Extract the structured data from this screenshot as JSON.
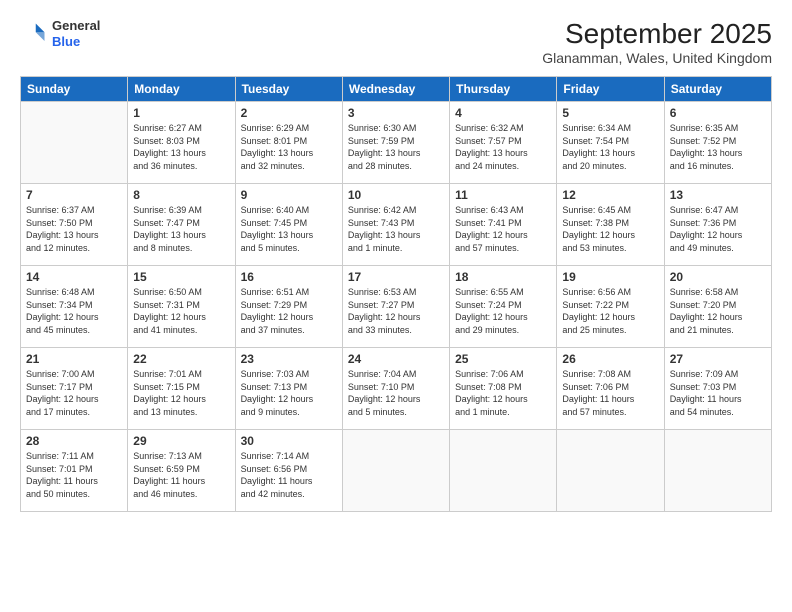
{
  "header": {
    "logo_general": "General",
    "logo_blue": "Blue",
    "month_title": "September 2025",
    "location": "Glanamman, Wales, United Kingdom"
  },
  "weekdays": [
    "Sunday",
    "Monday",
    "Tuesday",
    "Wednesday",
    "Thursday",
    "Friday",
    "Saturday"
  ],
  "weeks": [
    [
      {
        "day": "",
        "info": ""
      },
      {
        "day": "1",
        "info": "Sunrise: 6:27 AM\nSunset: 8:03 PM\nDaylight: 13 hours\nand 36 minutes."
      },
      {
        "day": "2",
        "info": "Sunrise: 6:29 AM\nSunset: 8:01 PM\nDaylight: 13 hours\nand 32 minutes."
      },
      {
        "day": "3",
        "info": "Sunrise: 6:30 AM\nSunset: 7:59 PM\nDaylight: 13 hours\nand 28 minutes."
      },
      {
        "day": "4",
        "info": "Sunrise: 6:32 AM\nSunset: 7:57 PM\nDaylight: 13 hours\nand 24 minutes."
      },
      {
        "day": "5",
        "info": "Sunrise: 6:34 AM\nSunset: 7:54 PM\nDaylight: 13 hours\nand 20 minutes."
      },
      {
        "day": "6",
        "info": "Sunrise: 6:35 AM\nSunset: 7:52 PM\nDaylight: 13 hours\nand 16 minutes."
      }
    ],
    [
      {
        "day": "7",
        "info": "Sunrise: 6:37 AM\nSunset: 7:50 PM\nDaylight: 13 hours\nand 12 minutes."
      },
      {
        "day": "8",
        "info": "Sunrise: 6:39 AM\nSunset: 7:47 PM\nDaylight: 13 hours\nand 8 minutes."
      },
      {
        "day": "9",
        "info": "Sunrise: 6:40 AM\nSunset: 7:45 PM\nDaylight: 13 hours\nand 5 minutes."
      },
      {
        "day": "10",
        "info": "Sunrise: 6:42 AM\nSunset: 7:43 PM\nDaylight: 13 hours\nand 1 minute."
      },
      {
        "day": "11",
        "info": "Sunrise: 6:43 AM\nSunset: 7:41 PM\nDaylight: 12 hours\nand 57 minutes."
      },
      {
        "day": "12",
        "info": "Sunrise: 6:45 AM\nSunset: 7:38 PM\nDaylight: 12 hours\nand 53 minutes."
      },
      {
        "day": "13",
        "info": "Sunrise: 6:47 AM\nSunset: 7:36 PM\nDaylight: 12 hours\nand 49 minutes."
      }
    ],
    [
      {
        "day": "14",
        "info": "Sunrise: 6:48 AM\nSunset: 7:34 PM\nDaylight: 12 hours\nand 45 minutes."
      },
      {
        "day": "15",
        "info": "Sunrise: 6:50 AM\nSunset: 7:31 PM\nDaylight: 12 hours\nand 41 minutes."
      },
      {
        "day": "16",
        "info": "Sunrise: 6:51 AM\nSunset: 7:29 PM\nDaylight: 12 hours\nand 37 minutes."
      },
      {
        "day": "17",
        "info": "Sunrise: 6:53 AM\nSunset: 7:27 PM\nDaylight: 12 hours\nand 33 minutes."
      },
      {
        "day": "18",
        "info": "Sunrise: 6:55 AM\nSunset: 7:24 PM\nDaylight: 12 hours\nand 29 minutes."
      },
      {
        "day": "19",
        "info": "Sunrise: 6:56 AM\nSunset: 7:22 PM\nDaylight: 12 hours\nand 25 minutes."
      },
      {
        "day": "20",
        "info": "Sunrise: 6:58 AM\nSunset: 7:20 PM\nDaylight: 12 hours\nand 21 minutes."
      }
    ],
    [
      {
        "day": "21",
        "info": "Sunrise: 7:00 AM\nSunset: 7:17 PM\nDaylight: 12 hours\nand 17 minutes."
      },
      {
        "day": "22",
        "info": "Sunrise: 7:01 AM\nSunset: 7:15 PM\nDaylight: 12 hours\nand 13 minutes."
      },
      {
        "day": "23",
        "info": "Sunrise: 7:03 AM\nSunset: 7:13 PM\nDaylight: 12 hours\nand 9 minutes."
      },
      {
        "day": "24",
        "info": "Sunrise: 7:04 AM\nSunset: 7:10 PM\nDaylight: 12 hours\nand 5 minutes."
      },
      {
        "day": "25",
        "info": "Sunrise: 7:06 AM\nSunset: 7:08 PM\nDaylight: 12 hours\nand 1 minute."
      },
      {
        "day": "26",
        "info": "Sunrise: 7:08 AM\nSunset: 7:06 PM\nDaylight: 11 hours\nand 57 minutes."
      },
      {
        "day": "27",
        "info": "Sunrise: 7:09 AM\nSunset: 7:03 PM\nDaylight: 11 hours\nand 54 minutes."
      }
    ],
    [
      {
        "day": "28",
        "info": "Sunrise: 7:11 AM\nSunset: 7:01 PM\nDaylight: 11 hours\nand 50 minutes."
      },
      {
        "day": "29",
        "info": "Sunrise: 7:13 AM\nSunset: 6:59 PM\nDaylight: 11 hours\nand 46 minutes."
      },
      {
        "day": "30",
        "info": "Sunrise: 7:14 AM\nSunset: 6:56 PM\nDaylight: 11 hours\nand 42 minutes."
      },
      {
        "day": "",
        "info": ""
      },
      {
        "day": "",
        "info": ""
      },
      {
        "day": "",
        "info": ""
      },
      {
        "day": "",
        "info": ""
      }
    ]
  ]
}
